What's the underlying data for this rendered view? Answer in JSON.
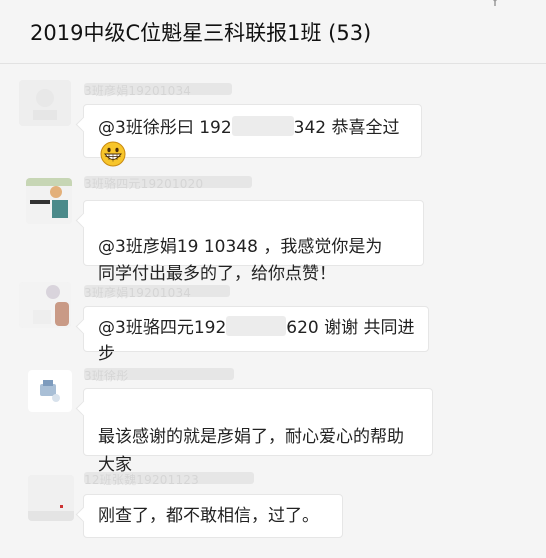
{
  "window": {
    "title": "2019中级C位魁星三科联报1班 (53)"
  },
  "messages": [
    {
      "sender": "3班彦娟19201034",
      "text_before": "@3班徐彤曰 192",
      "text_after": "342 恭喜全过",
      "emoji": "grinning-face-icon"
    },
    {
      "sender": "3班骆四元19201020",
      "text": "@3班彦娟19   10348 ，我感觉你是为\n同学付出最多的了，给你点赞！"
    },
    {
      "sender": "3班彦娟19201034",
      "text_before": "@3班骆四元192",
      "text_after": "620 谢谢 共同进步"
    },
    {
      "sender": "3班徐彤",
      "text": "最该感谢的就是彦娟了，耐心爱心的帮助\n大家"
    },
    {
      "sender": "12班张魏19201123",
      "text": "刚查了，都不敢相信，过了。"
    }
  ],
  "colors": {
    "background": "#f5f5f5",
    "bubble": "#ffffff",
    "name_text": "#b8b8b8"
  }
}
